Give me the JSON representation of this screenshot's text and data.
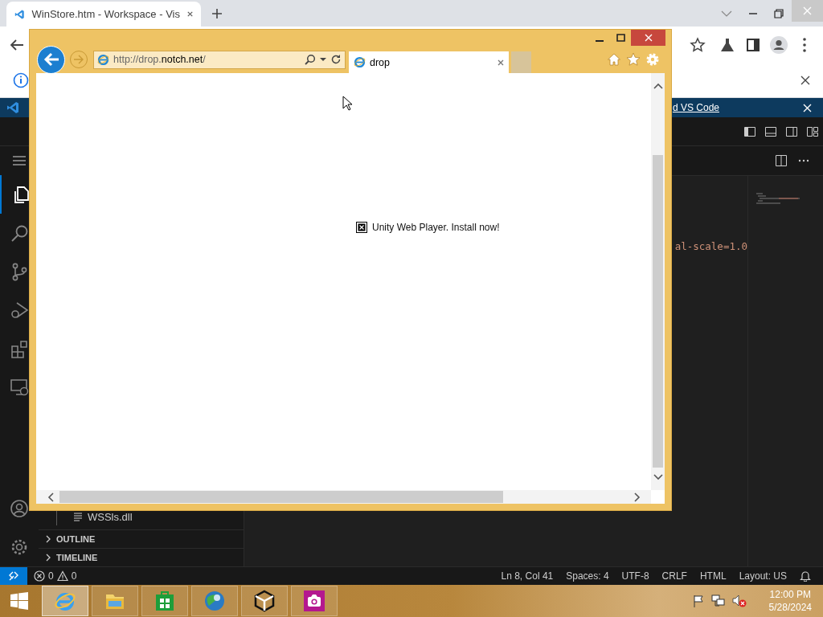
{
  "browser": {
    "tab": {
      "title": "WinStore.htm - Workspace - Vis",
      "selected": true
    },
    "banner_link": "d VS Code"
  },
  "vscode": {
    "activity": [
      {
        "kind": "explorer",
        "selected": true
      },
      {
        "kind": "search",
        "selected": false
      },
      {
        "kind": "source-control",
        "selected": false
      },
      {
        "kind": "run-debug",
        "selected": false
      },
      {
        "kind": "extensions",
        "selected": false
      },
      {
        "kind": "remote",
        "selected": false
      }
    ],
    "code_fragment": "al-scale=1.0",
    "explorer_file": "WSSls.dll",
    "sections": [
      {
        "label": "OUTLINE",
        "expanded": false
      },
      {
        "label": "TIMELINE",
        "expanded": false
      }
    ]
  },
  "status_bar": {
    "errors": "0",
    "warnings": "0",
    "items": [
      "Ln 8, Col 41",
      "Spaces: 4",
      "UTF-8",
      "CRLF",
      "HTML",
      "Layout: US"
    ]
  },
  "ie": {
    "address": "http://drop.**notch.net**/",
    "tab": {
      "title": "drop",
      "selected": true
    },
    "plugin_message": "Unity Web Player. Install now!"
  },
  "taskbar": {
    "apps": [
      {
        "kind": "ie",
        "selected": true
      },
      {
        "kind": "folder",
        "selected": false
      },
      {
        "kind": "store",
        "selected": false
      },
      {
        "kind": "globe",
        "selected": false
      },
      {
        "kind": "unity",
        "selected": false
      },
      {
        "kind": "camera",
        "selected": false
      }
    ],
    "time": "12:00 PM",
    "date": "5/28/2024"
  }
}
